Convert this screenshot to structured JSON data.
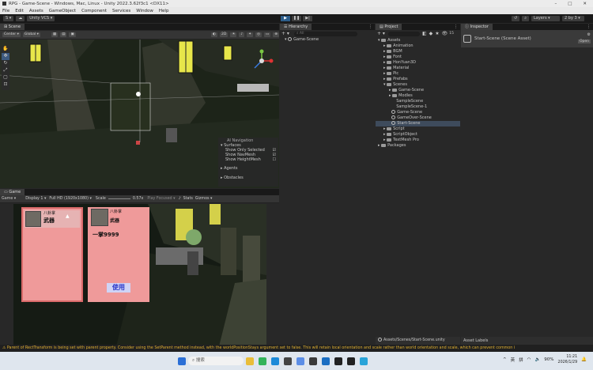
{
  "window": {
    "title": "RPG - Game-Scene - Windows, Mac, Linux - Unity 2022.3.62f3c1 <DX11>"
  },
  "menu": [
    "File",
    "Edit",
    "Assets",
    "GameObject",
    "Component",
    "Services",
    "Window",
    "Help"
  ],
  "toolbar": {
    "account": "S",
    "version_control": "Unity VCS",
    "layers": "Layers",
    "layout": "2 by 3"
  },
  "scene": {
    "tab": "Scene",
    "pivot": "Center",
    "space": "Global",
    "mode_2d": "2D"
  },
  "overlay": {
    "title": "AI Navigation",
    "surfaces": "Surfaces",
    "only_selected": "Show Only Selected",
    "navmesh": "Show NavMesh",
    "heightmesh": "Show HeightMesh",
    "agents": "Agents",
    "obstacles": "Obstacles"
  },
  "game": {
    "tab": "Game",
    "mode": "Game",
    "display": "Display 1",
    "resolution": "Full HD (1920x1080)",
    "scale_label": "Scale",
    "scale_value": "0.57x",
    "play_focused": "Play Focused",
    "stats": "Stats",
    "gizmos": "Gizmos"
  },
  "ui": {
    "card1_item": "八卦掌",
    "card1_name": "武器",
    "card2_item": "八卦掌",
    "card2_type": "武器",
    "card2_desc": "一掌9999",
    "use_button": "使用"
  },
  "hierarchy": {
    "tab": "Hierarchy",
    "search_placeholder": "All",
    "scene_root": "Game-Scene"
  },
  "project": {
    "tab": "Project",
    "badge": "15",
    "path": "Assets/Scenes/Start-Scene.unity",
    "tree": [
      {
        "label": "Assets",
        "depth": 0,
        "kind": "folder"
      },
      {
        "label": "Animation",
        "depth": 1,
        "kind": "folder"
      },
      {
        "label": "BGM",
        "depth": 1,
        "kind": "folder"
      },
      {
        "label": "Font",
        "depth": 1,
        "kind": "folder"
      },
      {
        "label": "HonYuan3D",
        "depth": 1,
        "kind": "folder"
      },
      {
        "label": "Material",
        "depth": 1,
        "kind": "folder"
      },
      {
        "label": "Pic",
        "depth": 1,
        "kind": "folder"
      },
      {
        "label": "Prefabs",
        "depth": 1,
        "kind": "folder"
      },
      {
        "label": "Scenes",
        "depth": 1,
        "kind": "folder"
      },
      {
        "label": "Game-Scene",
        "depth": 2,
        "kind": "folder"
      },
      {
        "label": "Modles",
        "depth": 2,
        "kind": "folder"
      },
      {
        "label": "SampleScene",
        "depth": 2,
        "kind": "plain"
      },
      {
        "label": "SampleScene-1",
        "depth": 2,
        "kind": "plain"
      },
      {
        "label": "Game-Scene",
        "depth": 2,
        "kind": "unity"
      },
      {
        "label": "GameOver-Scene",
        "depth": 2,
        "kind": "unity"
      },
      {
        "label": "Start-Scene",
        "depth": 2,
        "kind": "unity",
        "selected": true
      },
      {
        "label": "Script",
        "depth": 1,
        "kind": "folder"
      },
      {
        "label": "ScriptObject",
        "depth": 1,
        "kind": "folder"
      },
      {
        "label": "TextMesh Pro",
        "depth": 1,
        "kind": "folder"
      },
      {
        "label": "Packages",
        "depth": 0,
        "kind": "folder"
      }
    ]
  },
  "inspector": {
    "tab": "Inspector",
    "asset_title": "Start-Scene (Scene Asset)",
    "open_button": "Open",
    "asset_labels": "Asset Labels"
  },
  "status": {
    "message": "Parent of RectTransform is being set with parent property. Consider using the SetParent method instead, with the worldPositionStays argument set to false. This will retain local orientation and scale rather than world orientation and scale, which can prevent common i"
  },
  "taskbar": {
    "search_placeholder": "搜索",
    "lang1": "英",
    "lang2": "拼",
    "battery": "90%",
    "time": "11:21",
    "date": "2026/1/29"
  },
  "colors": {
    "card": "#ef9a9a",
    "card_border": "#d96a6a",
    "accent": "#2c5d8a",
    "warning": "#e0b030"
  }
}
